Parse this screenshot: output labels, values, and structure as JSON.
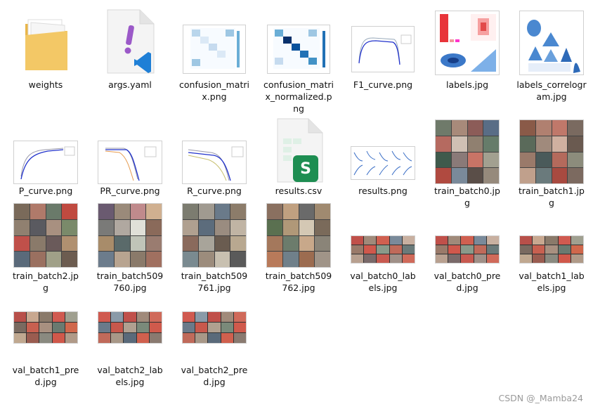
{
  "files": [
    {
      "name": "weights",
      "type": "folder"
    },
    {
      "name": "args.yaml",
      "type": "yaml"
    },
    {
      "name": "confusion_matrix.png",
      "type": "matrix"
    },
    {
      "name": "confusion_matrix_normalized.png",
      "type": "matrix-norm"
    },
    {
      "name": "F1_curve.png",
      "type": "curve"
    },
    {
      "name": "labels.jpg",
      "type": "labels"
    },
    {
      "name": "labels_correlogram.jpg",
      "type": "correlogram"
    },
    {
      "name": "P_curve.png",
      "type": "curve"
    },
    {
      "name": "PR_curve.png",
      "type": "curve"
    },
    {
      "name": "R_curve.png",
      "type": "curve"
    },
    {
      "name": "results.csv",
      "type": "csv"
    },
    {
      "name": "results.png",
      "type": "results"
    },
    {
      "name": "train_batch0.jpg",
      "type": "mosaic"
    },
    {
      "name": "train_batch1.jpg",
      "type": "mosaic"
    },
    {
      "name": "train_batch2.jpg",
      "type": "mosaic"
    },
    {
      "name": "train_batch509760.jpg",
      "type": "mosaic"
    },
    {
      "name": "train_batch509761.jpg",
      "type": "mosaic"
    },
    {
      "name": "train_batch509762.jpg",
      "type": "mosaic"
    },
    {
      "name": "val_batch0_labels.jpg",
      "type": "strip"
    },
    {
      "name": "val_batch0_pred.jpg",
      "type": "strip"
    },
    {
      "name": "val_batch1_labels.jpg",
      "type": "strip"
    },
    {
      "name": "val_batch1_pred.jpg",
      "type": "strip"
    },
    {
      "name": "val_batch2_labels.jpg",
      "type": "strip"
    },
    {
      "name": "val_batch2_pred.jpg",
      "type": "strip"
    }
  ],
  "watermark": "CSDN @_Mamba24"
}
